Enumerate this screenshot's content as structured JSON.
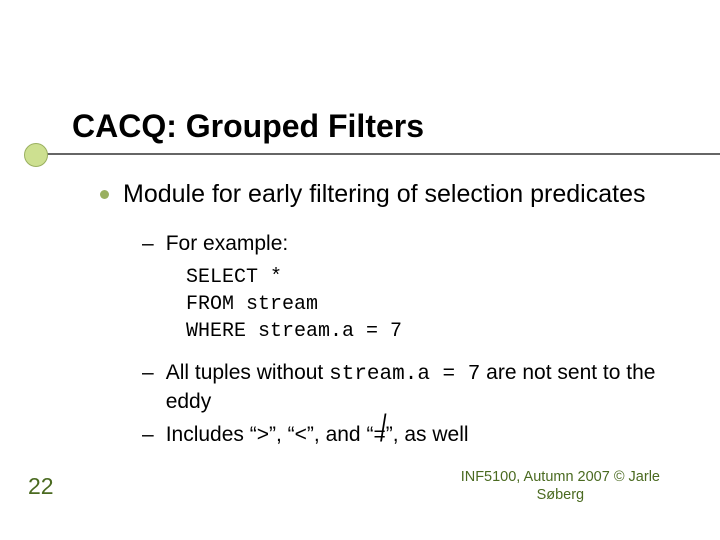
{
  "title": "CACQ: Grouped Filters",
  "body": {
    "main_point": "Module for early filtering of selection predicates",
    "sub": {
      "for_example": "For example:",
      "code_line1": "SELECT *",
      "code_line2": "FROM stream",
      "code_line3": "WHERE stream.a = 7",
      "point2_a": "All tuples without ",
      "point2_code": "stream.a = 7",
      "point2_b": " are not sent to the eddy",
      "point3_a": "Includes “>”, “<”, and “",
      "point3_neq_base": "=",
      "point3_neq_slash": "/",
      "point3_b": "”, as well"
    }
  },
  "slide_number": "22",
  "footer_line1": "INF5100, Autumn 2007 © Jarle",
  "footer_line2": "Søberg"
}
